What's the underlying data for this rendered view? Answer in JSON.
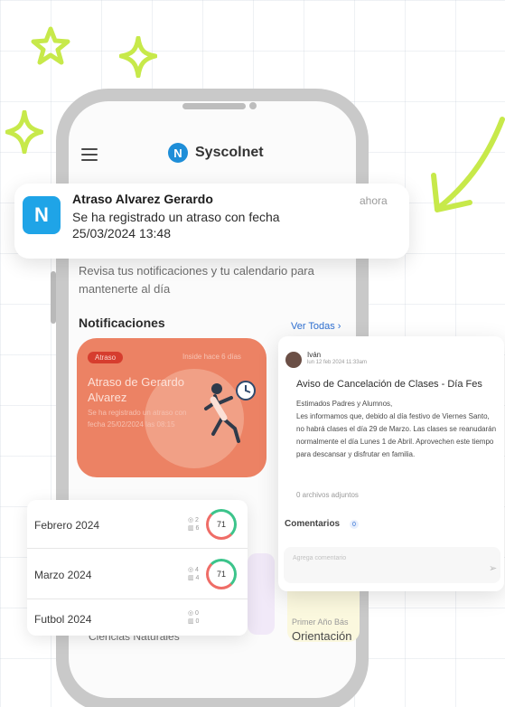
{
  "colors": {
    "accent_green": "#c7e94a",
    "brand_blue": "#1e8ed8",
    "card_orange": "#ec8264",
    "link_blue": "#2e6fd1"
  },
  "app": {
    "name": "Syscolnet",
    "logo_letter": "N",
    "intro": "Revisa tus notificaciones y tu calendario para mantenerte al día"
  },
  "push": {
    "icon_letter": "N",
    "title": "Atraso Alvarez Gerardo",
    "line1": "Se ha registrado un atraso con fecha",
    "line2": "25/03/2024 13:48",
    "time": "ahora"
  },
  "notifications": {
    "heading": "Notificaciones",
    "view_all": "Ver Todas ›",
    "card": {
      "badge": "Atraso",
      "time": "Inside hace 6 días",
      "title": "Atraso de Gerardo Alvarez",
      "body": "Se ha registrado un atraso con fecha 25/02/2024 las 08:15"
    }
  },
  "months": [
    {
      "label": "Febrero 2024",
      "mini1": "◎ 2",
      "mini2": "▥ 6",
      "score": "71"
    },
    {
      "label": "Marzo 2024",
      "mini1": "◎ 4",
      "mini2": "▥ 4",
      "score": "71"
    },
    {
      "label": "Futbol 2024",
      "mini1": "◎ 0",
      "mini2": "▥ 0",
      "score": ""
    }
  ],
  "courses": {
    "left": "Ciencias Naturales",
    "right_small": "Primer Año Bás",
    "right": "Orientación"
  },
  "message": {
    "author": "Iván",
    "date": "lun 12 feb 2024 11:33am",
    "title": "Aviso de Cancelación de Clases - Día Fes",
    "greeting": "Estimados Padres y Alumnos,",
    "body": "Les informamos que, debido al día festivo de Viernes Santo, no habrá clases el día 29 de Marzo. Las clases se reanudarán normalmente el día Lunes 1 de Abril. Aprovechen este tiempo para descansar y disfrutar en familia.",
    "attachments": "0 archivos adjuntos",
    "comments_label": "Comentarios",
    "comments_count": "0",
    "comment_placeholder": "Agrega comentario"
  }
}
